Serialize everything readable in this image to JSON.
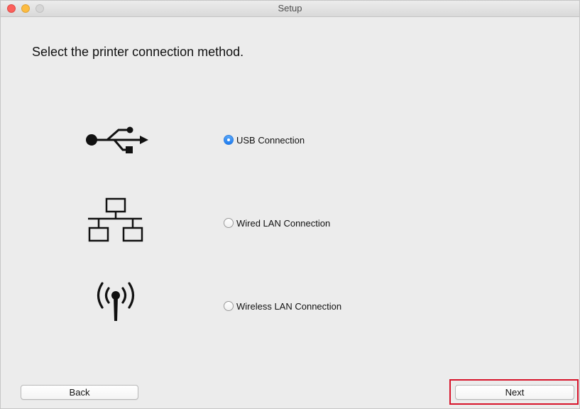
{
  "window": {
    "title": "Setup"
  },
  "heading": "Select the printer connection method.",
  "options": [
    {
      "icon": "usb-icon",
      "label": "USB Connection",
      "selected": true
    },
    {
      "icon": "wired-network-icon",
      "label": "Wired LAN Connection",
      "selected": false
    },
    {
      "icon": "wireless-antenna-icon",
      "label": "Wireless LAN Connection",
      "selected": false
    }
  ],
  "buttons": {
    "back_label": "Back",
    "next_label": "Next"
  },
  "colors": {
    "radio_selected": "#1e7bf0",
    "highlight_border": "#d7142a"
  }
}
